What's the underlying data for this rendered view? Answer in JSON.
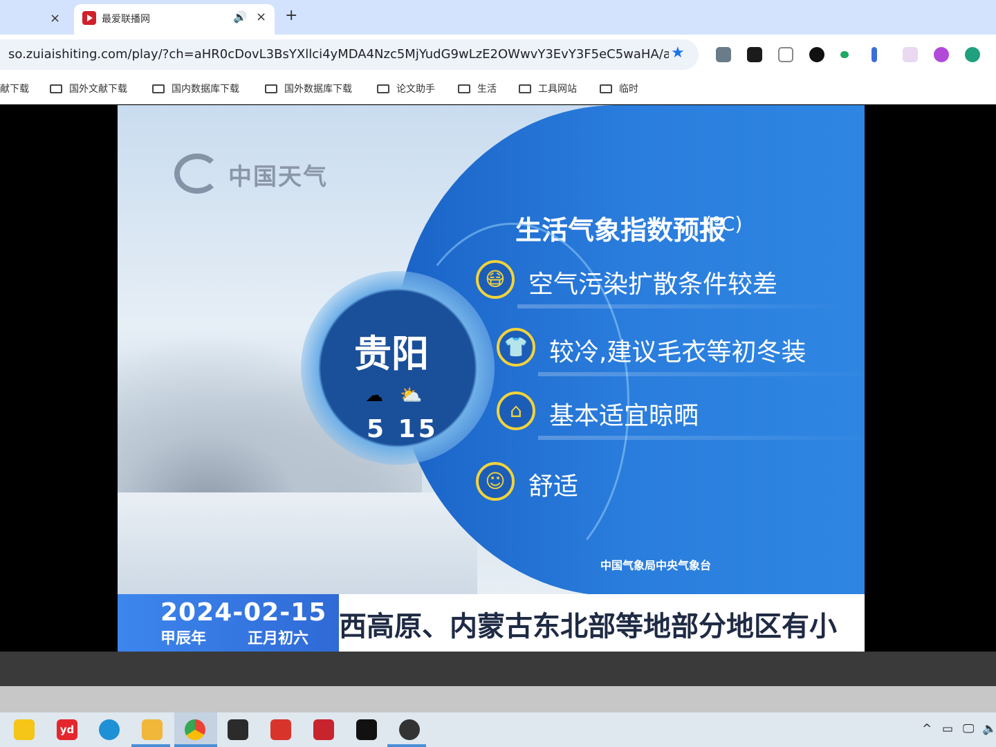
{
  "browser": {
    "tabs": [
      {
        "title": "",
        "close": "×"
      },
      {
        "title": "最爱联播网",
        "close": "×",
        "audio": "🔊"
      }
    ],
    "new_tab": "+",
    "url": "so.zuiaishiting.com/play/?ch=aHR0cDovL3BsYXllci4yMDA4Nzc5MjYudG9wLzE2OWwvY3EvY3F5eC5waHA/aWQ9...",
    "bookmarks": [
      "献下载",
      "国外文献下载",
      "国内数据库下载",
      "国外数据库下载",
      "论文助手",
      "生活",
      "工具网站",
      "临时"
    ],
    "extensions": [
      "stamp-icon",
      "face-icon",
      "document-icon",
      "infinity-icon",
      "chat-icon",
      "edit-icon",
      "cat-icon",
      "brain-icon",
      "chatgpt-icon"
    ]
  },
  "video": {
    "logo": "中国天气",
    "title": "生活气象指数预报",
    "unit": "(°C)",
    "city": "贵阳",
    "weather_icons": [
      "cloudy-icon",
      "partly-cloudy-icon"
    ],
    "temp_low": "5",
    "temp_high": "15",
    "items": [
      {
        "icon": "mask-icon",
        "text": "空气污染扩散条件较差"
      },
      {
        "icon": "shirt-icon",
        "text": "较冷,建议毛衣等初冬装"
      },
      {
        "icon": "hanger-icon",
        "text": "基本适宜晾晒"
      },
      {
        "icon": "smile-icon",
        "text": "舒适"
      }
    ],
    "source": "中国气象局中央气象台",
    "date": "2024-02-15",
    "lunar_year": "甲辰年",
    "lunar_day": "正月初六",
    "ticker": "西高原、内蒙古东北部等地部分地区有小"
  },
  "taskbar": {
    "apps": [
      "sticky-notes-icon",
      "youdao-icon",
      "edge-icon",
      "file-explorer-icon",
      "chrome-icon",
      "terminal-icon",
      "wps-icon",
      "zotero-icon",
      "capcut-icon",
      "screenshot-icon"
    ],
    "youdao_label": "yd",
    "tray": [
      "^",
      "▭",
      "🖵",
      "🔈"
    ]
  }
}
